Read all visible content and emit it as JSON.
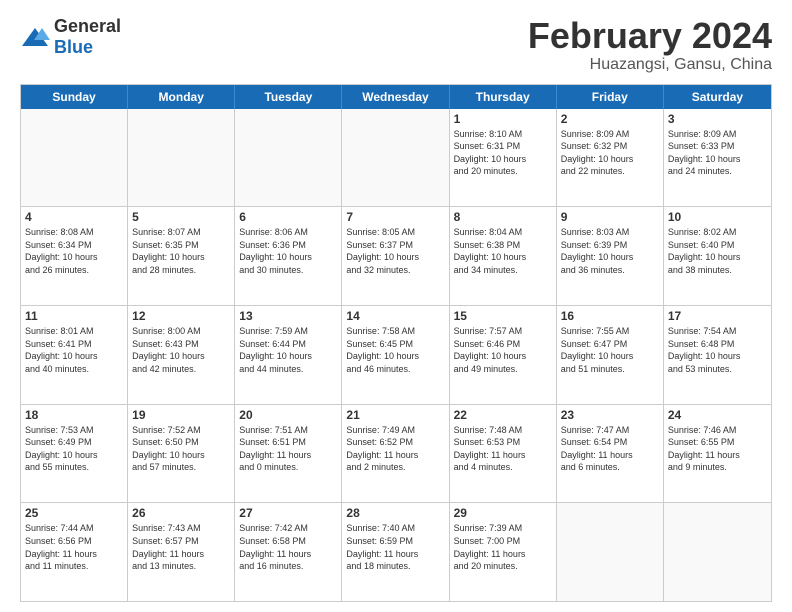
{
  "header": {
    "logo_general": "General",
    "logo_blue": "Blue",
    "month": "February 2024",
    "location": "Huazangsi, Gansu, China"
  },
  "weekdays": [
    "Sunday",
    "Monday",
    "Tuesday",
    "Wednesday",
    "Thursday",
    "Friday",
    "Saturday"
  ],
  "rows": [
    [
      {
        "day": "",
        "info": "",
        "empty": true
      },
      {
        "day": "",
        "info": "",
        "empty": true
      },
      {
        "day": "",
        "info": "",
        "empty": true
      },
      {
        "day": "",
        "info": "",
        "empty": true
      },
      {
        "day": "1",
        "info": "Sunrise: 8:10 AM\nSunset: 6:31 PM\nDaylight: 10 hours\nand 20 minutes.",
        "empty": false
      },
      {
        "day": "2",
        "info": "Sunrise: 8:09 AM\nSunset: 6:32 PM\nDaylight: 10 hours\nand 22 minutes.",
        "empty": false
      },
      {
        "day": "3",
        "info": "Sunrise: 8:09 AM\nSunset: 6:33 PM\nDaylight: 10 hours\nand 24 minutes.",
        "empty": false
      }
    ],
    [
      {
        "day": "4",
        "info": "Sunrise: 8:08 AM\nSunset: 6:34 PM\nDaylight: 10 hours\nand 26 minutes.",
        "empty": false
      },
      {
        "day": "5",
        "info": "Sunrise: 8:07 AM\nSunset: 6:35 PM\nDaylight: 10 hours\nand 28 minutes.",
        "empty": false
      },
      {
        "day": "6",
        "info": "Sunrise: 8:06 AM\nSunset: 6:36 PM\nDaylight: 10 hours\nand 30 minutes.",
        "empty": false
      },
      {
        "day": "7",
        "info": "Sunrise: 8:05 AM\nSunset: 6:37 PM\nDaylight: 10 hours\nand 32 minutes.",
        "empty": false
      },
      {
        "day": "8",
        "info": "Sunrise: 8:04 AM\nSunset: 6:38 PM\nDaylight: 10 hours\nand 34 minutes.",
        "empty": false
      },
      {
        "day": "9",
        "info": "Sunrise: 8:03 AM\nSunset: 6:39 PM\nDaylight: 10 hours\nand 36 minutes.",
        "empty": false
      },
      {
        "day": "10",
        "info": "Sunrise: 8:02 AM\nSunset: 6:40 PM\nDaylight: 10 hours\nand 38 minutes.",
        "empty": false
      }
    ],
    [
      {
        "day": "11",
        "info": "Sunrise: 8:01 AM\nSunset: 6:41 PM\nDaylight: 10 hours\nand 40 minutes.",
        "empty": false
      },
      {
        "day": "12",
        "info": "Sunrise: 8:00 AM\nSunset: 6:43 PM\nDaylight: 10 hours\nand 42 minutes.",
        "empty": false
      },
      {
        "day": "13",
        "info": "Sunrise: 7:59 AM\nSunset: 6:44 PM\nDaylight: 10 hours\nand 44 minutes.",
        "empty": false
      },
      {
        "day": "14",
        "info": "Sunrise: 7:58 AM\nSunset: 6:45 PM\nDaylight: 10 hours\nand 46 minutes.",
        "empty": false
      },
      {
        "day": "15",
        "info": "Sunrise: 7:57 AM\nSunset: 6:46 PM\nDaylight: 10 hours\nand 49 minutes.",
        "empty": false
      },
      {
        "day": "16",
        "info": "Sunrise: 7:55 AM\nSunset: 6:47 PM\nDaylight: 10 hours\nand 51 minutes.",
        "empty": false
      },
      {
        "day": "17",
        "info": "Sunrise: 7:54 AM\nSunset: 6:48 PM\nDaylight: 10 hours\nand 53 minutes.",
        "empty": false
      }
    ],
    [
      {
        "day": "18",
        "info": "Sunrise: 7:53 AM\nSunset: 6:49 PM\nDaylight: 10 hours\nand 55 minutes.",
        "empty": false
      },
      {
        "day": "19",
        "info": "Sunrise: 7:52 AM\nSunset: 6:50 PM\nDaylight: 10 hours\nand 57 minutes.",
        "empty": false
      },
      {
        "day": "20",
        "info": "Sunrise: 7:51 AM\nSunset: 6:51 PM\nDaylight: 11 hours\nand 0 minutes.",
        "empty": false
      },
      {
        "day": "21",
        "info": "Sunrise: 7:49 AM\nSunset: 6:52 PM\nDaylight: 11 hours\nand 2 minutes.",
        "empty": false
      },
      {
        "day": "22",
        "info": "Sunrise: 7:48 AM\nSunset: 6:53 PM\nDaylight: 11 hours\nand 4 minutes.",
        "empty": false
      },
      {
        "day": "23",
        "info": "Sunrise: 7:47 AM\nSunset: 6:54 PM\nDaylight: 11 hours\nand 6 minutes.",
        "empty": false
      },
      {
        "day": "24",
        "info": "Sunrise: 7:46 AM\nSunset: 6:55 PM\nDaylight: 11 hours\nand 9 minutes.",
        "empty": false
      }
    ],
    [
      {
        "day": "25",
        "info": "Sunrise: 7:44 AM\nSunset: 6:56 PM\nDaylight: 11 hours\nand 11 minutes.",
        "empty": false
      },
      {
        "day": "26",
        "info": "Sunrise: 7:43 AM\nSunset: 6:57 PM\nDaylight: 11 hours\nand 13 minutes.",
        "empty": false
      },
      {
        "day": "27",
        "info": "Sunrise: 7:42 AM\nSunset: 6:58 PM\nDaylight: 11 hours\nand 16 minutes.",
        "empty": false
      },
      {
        "day": "28",
        "info": "Sunrise: 7:40 AM\nSunset: 6:59 PM\nDaylight: 11 hours\nand 18 minutes.",
        "empty": false
      },
      {
        "day": "29",
        "info": "Sunrise: 7:39 AM\nSunset: 7:00 PM\nDaylight: 11 hours\nand 20 minutes.",
        "empty": false
      },
      {
        "day": "",
        "info": "",
        "empty": true
      },
      {
        "day": "",
        "info": "",
        "empty": true
      }
    ]
  ]
}
